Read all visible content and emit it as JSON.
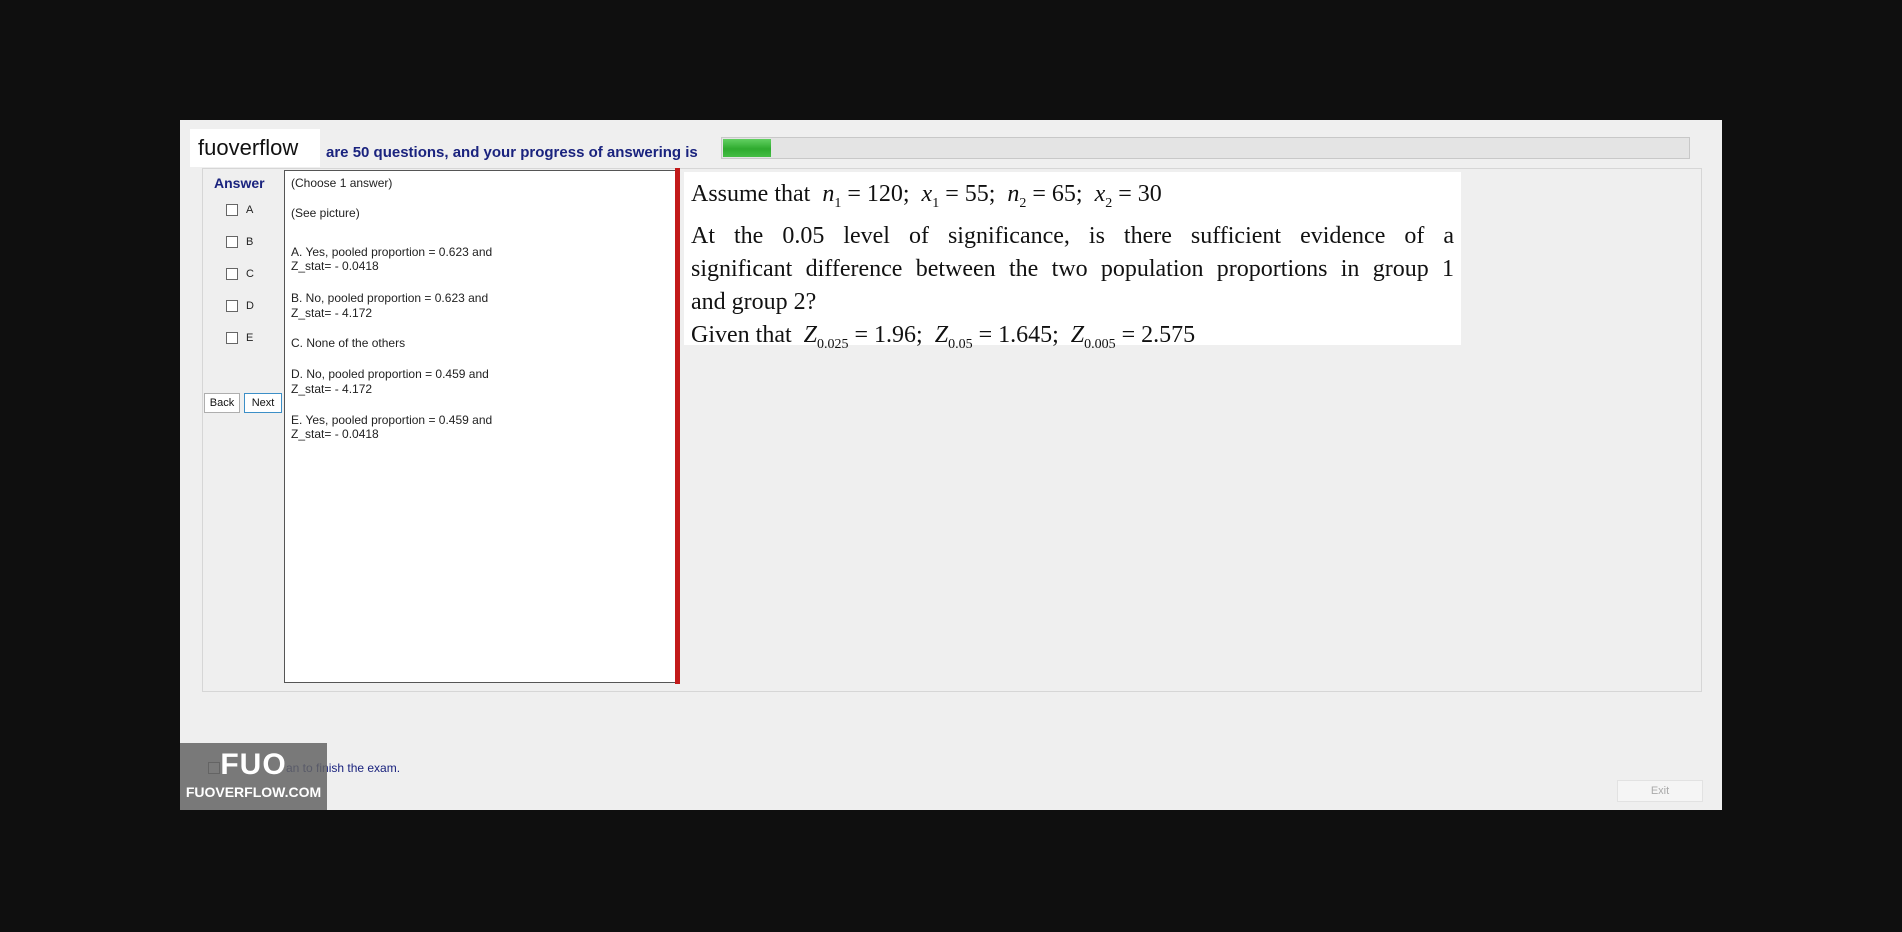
{
  "header": {
    "logo": "fuoverflow",
    "progress_text": "are 50 questions, and your progress of answering is",
    "progress_fraction": 0.05
  },
  "answer_panel": {
    "title": "Answer",
    "options": [
      "A",
      "B",
      "C",
      "D",
      "E"
    ],
    "back_label": "Back",
    "next_label": "Next"
  },
  "question": {
    "instruction": "(Choose 1 answer)",
    "see_picture": "(See picture)",
    "choice_lines": [
      "A.  Yes, pooled proportion = 0.623 and",
      "Z_stat= - 0.0418",
      "B.  No, pooled proportion = 0.623 and",
      "Z_stat= - 4.172",
      "C.  None of the others",
      "D.  No, pooled proportion = 0.459 and",
      "Z_stat= - 4.172",
      "E.  Yes, pooled proportion = 0.459 and",
      "Z_stat= - 0.0418"
    ]
  },
  "question_image": {
    "assume_prefix": "Assume that",
    "n1_sym": "n",
    "n1_sub": "1",
    "n1_val": " = 120;",
    "x1_sym": "x",
    "x1_sub": "1",
    "x1_val": " = 55;",
    "n2_sym": "n",
    "n2_sub": "2",
    "n2_val": " = 65;",
    "x2_sym": "x",
    "x2_sub": "2",
    "x2_val": " = 30",
    "line2": "At the 0.05 level of significance, is there sufficient evidence of a",
    "line3": "significant difference between the two population proportions in group 1",
    "line4": "and group 2?",
    "given_prefix": "Given that",
    "z1_sym": "Z",
    "z1_sub": "0.025",
    "z1_val": " = 1.96;",
    "z2_sym": "Z",
    "z2_sub": "0.05",
    "z2_val": " = 1.645;",
    "z3_sym": "Z",
    "z3_sub": "0.005",
    "z3_val": " = 2.575"
  },
  "footer": {
    "finish_text": "an to finish the exam.",
    "exit_label": "Exit",
    "watermark_big": "FUO",
    "watermark_small": "FUOVERFLOW.COM"
  }
}
